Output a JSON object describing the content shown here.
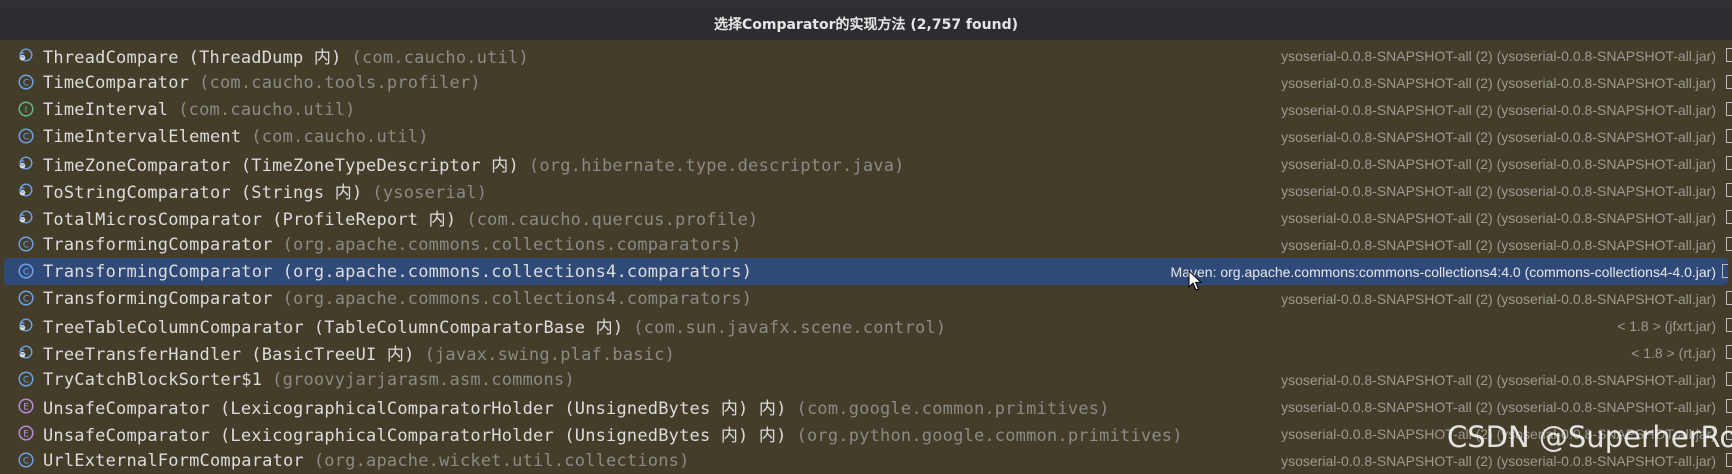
{
  "dialog": {
    "title": "选择Comparator的实现方法 (2,757 found)"
  },
  "rows": [
    {
      "icon": "inner-class-icon",
      "name": "ThreadCompare",
      "owner": "(ThreadDump 内)",
      "pkg": "(com.caucho.util)",
      "location": "ysoserial-0.0.8-SNAPSHOT-all (2) (ysoserial-0.0.8-SNAPSHOT-all.jar)"
    },
    {
      "icon": "class-icon",
      "name": "TimeComparator",
      "owner": "",
      "pkg": "(com.caucho.tools.profiler)",
      "location": "ysoserial-0.0.8-SNAPSHOT-all (2) (ysoserial-0.0.8-SNAPSHOT-all.jar)"
    },
    {
      "icon": "interface-icon",
      "name": "TimeInterval",
      "owner": "",
      "pkg": "(com.caucho.util)",
      "location": "ysoserial-0.0.8-SNAPSHOT-all (2) (ysoserial-0.0.8-SNAPSHOT-all.jar)"
    },
    {
      "icon": "class-icon",
      "name": "TimeIntervalElement",
      "owner": "",
      "pkg": "(com.caucho.util)",
      "location": "ysoserial-0.0.8-SNAPSHOT-all (2) (ysoserial-0.0.8-SNAPSHOT-all.jar)"
    },
    {
      "icon": "inner-class-icon",
      "name": "TimeZoneComparator",
      "owner": "(TimeZoneTypeDescriptor 内)",
      "pkg": "(org.hibernate.type.descriptor.java)",
      "location": "ysoserial-0.0.8-SNAPSHOT-all (2) (ysoserial-0.0.8-SNAPSHOT-all.jar)"
    },
    {
      "icon": "inner-class-icon",
      "name": "ToStringComparator",
      "owner": "(Strings 内)",
      "pkg": "(ysoserial)",
      "location": "ysoserial-0.0.8-SNAPSHOT-all (2) (ysoserial-0.0.8-SNAPSHOT-all.jar)"
    },
    {
      "icon": "inner-class-icon",
      "name": "TotalMicrosComparator",
      "owner": "(ProfileReport 内)",
      "pkg": "(com.caucho.quercus.profile)",
      "location": "ysoserial-0.0.8-SNAPSHOT-all (2) (ysoserial-0.0.8-SNAPSHOT-all.jar)"
    },
    {
      "icon": "class-icon",
      "name": "TransformingComparator",
      "owner": "",
      "pkg": "(org.apache.commons.collections.comparators)",
      "location": "ysoserial-0.0.8-SNAPSHOT-all (2) (ysoserial-0.0.8-SNAPSHOT-all.jar)"
    },
    {
      "icon": "class-icon",
      "name": "TransformingComparator",
      "owner": "",
      "pkg": "(org.apache.commons.collections4.comparators)",
      "location": "Maven: org.apache.commons:commons-collections4:4.0 (commons-collections4-4.0.jar)",
      "selected": true
    },
    {
      "icon": "class-icon",
      "name": "TransformingComparator",
      "owner": "",
      "pkg": "(org.apache.commons.collections4.comparators)",
      "location": "ysoserial-0.0.8-SNAPSHOT-all (2) (ysoserial-0.0.8-SNAPSHOT-all.jar)"
    },
    {
      "icon": "inner-class-icon",
      "name": "TreeTableColumnComparator",
      "owner": "(TableColumnComparatorBase 内)",
      "pkg": "(com.sun.javafx.scene.control)",
      "location": "< 1.8 > (jfxrt.jar)"
    },
    {
      "icon": "inner-class-icon",
      "name": "TreeTransferHandler",
      "owner": "(BasicTreeUI 内)",
      "pkg": "(javax.swing.plaf.basic)",
      "location": "< 1.8 > (rt.jar)"
    },
    {
      "icon": "class-icon",
      "name": "TryCatchBlockSorter$1",
      "owner": "",
      "pkg": "(groovyjarjarasm.asm.commons)",
      "location": "ysoserial-0.0.8-SNAPSHOT-all (2) (ysoserial-0.0.8-SNAPSHOT-all.jar)"
    },
    {
      "icon": "enum-icon",
      "name": "UnsafeComparator",
      "owner": "(LexicographicalComparatorHolder (UnsignedBytes 内) 内)",
      "pkg": "(com.google.common.primitives)",
      "location": "ysoserial-0.0.8-SNAPSHOT-all (2) (ysoserial-0.0.8-SNAPSHOT-all.jar)"
    },
    {
      "icon": "enum-icon",
      "name": "UnsafeComparator",
      "owner": "(LexicographicalComparatorHolder (UnsignedBytes 内) 内)",
      "pkg": "(org.python.google.common.primitives)",
      "location": "ysoserial-0.0.8-SNAPSHOT-all (2) (ysoserial-0.0.8-SNAPSHOT-all.jar)"
    },
    {
      "icon": "class-icon",
      "name": "UrlExternalFormComparator",
      "owner": "",
      "pkg": "(org.apache.wicket.util.collections)",
      "location": "ysoserial-0.0.8-SNAPSHOT-all (2) (ysoserial-0.0.8-SNAPSHOT-all.jar)"
    }
  ],
  "watermark": "CSDN @SuperherRo",
  "colors": {
    "class": "#6ea0e6",
    "interface": "#5fb87a",
    "enum": "#b78ad8",
    "selected": "#2f4a78"
  }
}
